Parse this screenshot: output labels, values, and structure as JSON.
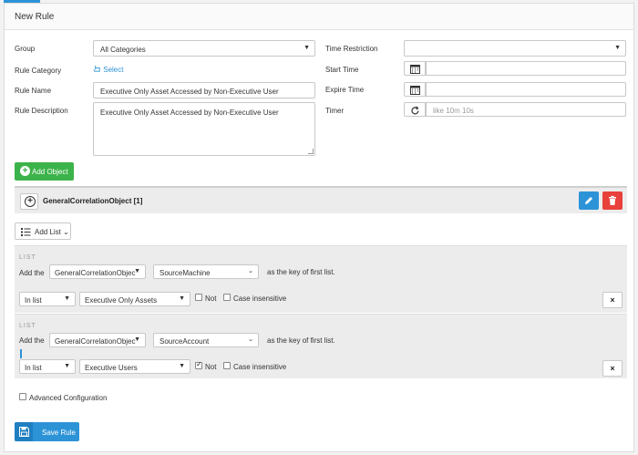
{
  "header": {
    "title": "New Rule"
  },
  "form": {
    "group_label": "Group",
    "group_value": "All Categories",
    "category_label": "Rule Category",
    "category_link": "Select",
    "name_label": "Rule Name",
    "name_value": "Executive Only Asset Accessed by Non-Executive User",
    "desc_label": "Rule Description",
    "desc_value": "Executive Only Asset Accessed by Non-Executive User",
    "time_restriction_label": "Time Restriction",
    "time_restriction_value": "",
    "start_time_label": "Start Time",
    "start_time_value": "",
    "expire_time_label": "Expire Time",
    "expire_time_value": "",
    "timer_label": "Timer",
    "timer_placeholder": "like 10m 10s"
  },
  "add_object_label": "Add Object",
  "object": {
    "name": "GeneralCorrelationObject [1]"
  },
  "add_list_label": "Add List",
  "lists": [
    {
      "caption": "LIST",
      "add_the": "Add the",
      "object_value": "GeneralCorrelationObjec",
      "field_value": "SourceMachine",
      "key_text": "as the key of first list.",
      "op_value": "In list",
      "list_value": "Executive Only Assets",
      "not_label": "Not",
      "not_checked": false,
      "case_label": "Case insensitive",
      "case_checked": false,
      "remove_label": "×"
    },
    {
      "caption": "LIST",
      "add_the": "Add the",
      "object_value": "GeneralCorrelationObjec",
      "field_value": "SourceAccount",
      "key_text": "as the key of first list.",
      "op_value": "In list",
      "list_value": "Executive Users",
      "not_label": "Not",
      "not_checked": true,
      "case_label": "Case insensitive",
      "case_checked": false,
      "remove_label": "×"
    }
  ],
  "advanced_label": "Advanced Configuration",
  "save_label": "Save Rule",
  "colors": {
    "accent": "#2d93d7",
    "green": "#3cb34a",
    "red": "#e8403a"
  }
}
